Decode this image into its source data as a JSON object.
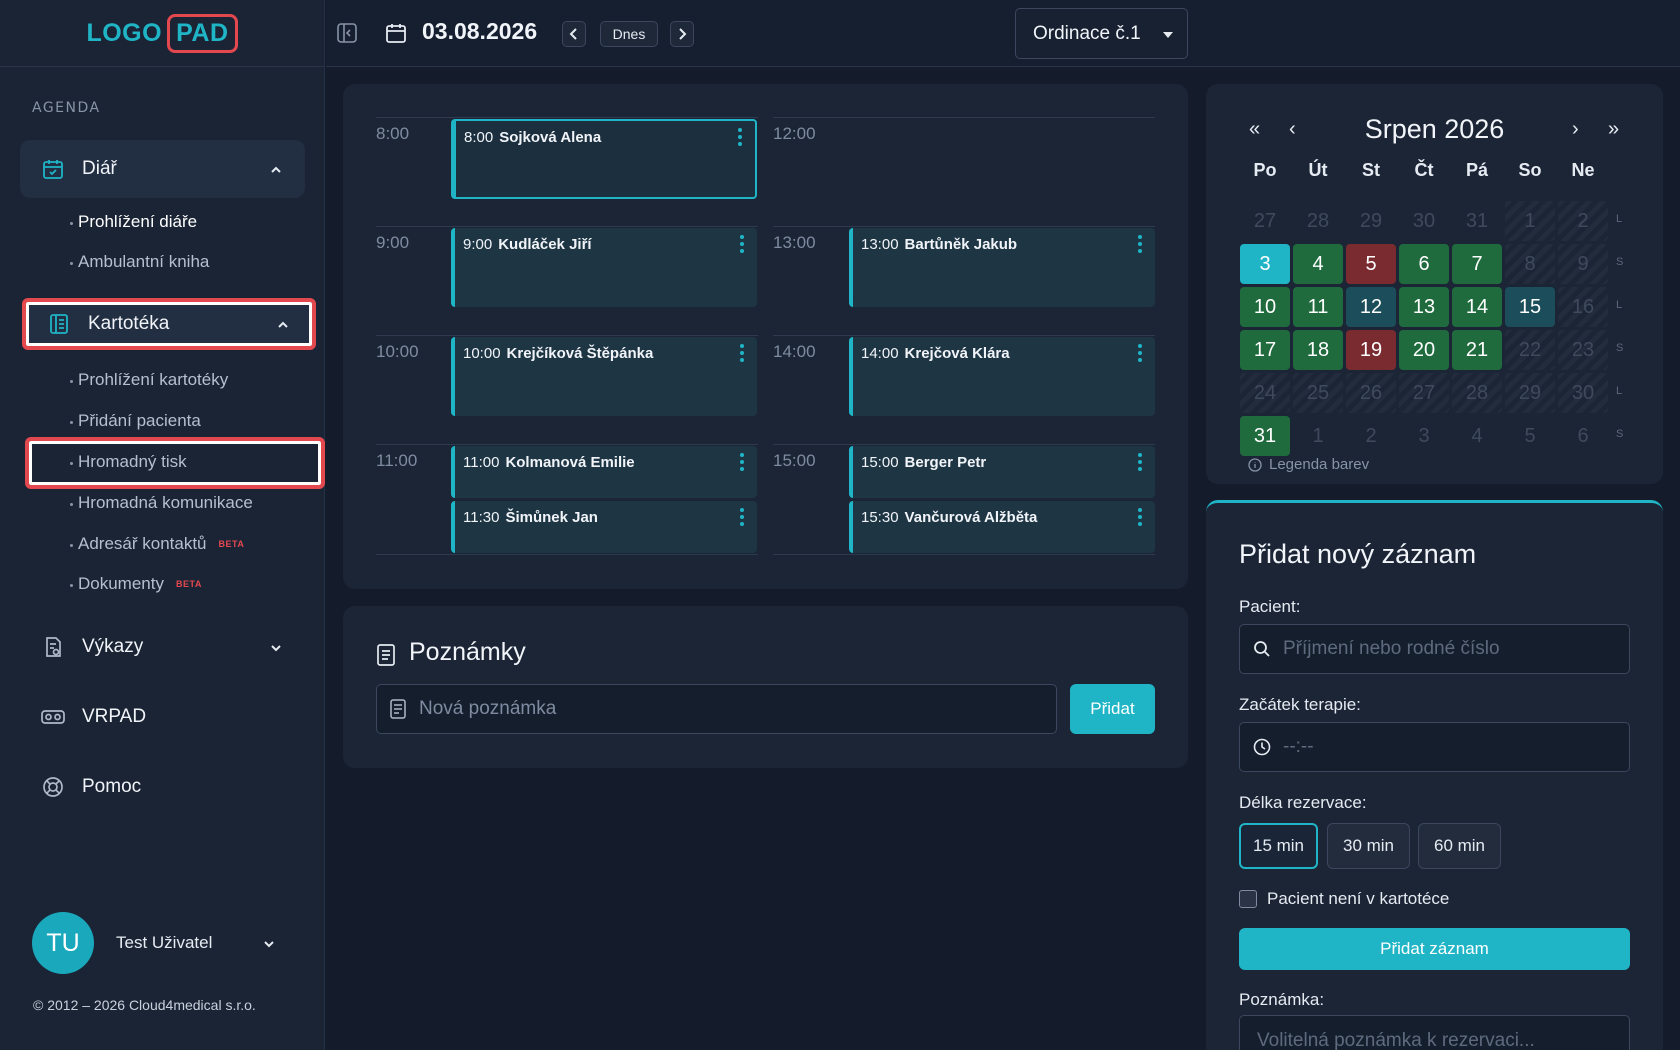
{
  "logo": {
    "part1": "LOGO",
    "part2": "PAD"
  },
  "sidebar": {
    "section_label": "AGENDA",
    "diar": {
      "label": "Diář",
      "items": [
        "Prohlížení diáře",
        "Ambulantní kniha"
      ]
    },
    "kartoteka": {
      "label": "Kartotéka",
      "items": [
        {
          "label": "Prohlížení kartotéky"
        },
        {
          "label": "Přidání pacienta"
        },
        {
          "label": "Hromadný tisk"
        },
        {
          "label": "Hromadná komunikace"
        },
        {
          "label": "Adresář kontaktů",
          "badge": "BETA"
        },
        {
          "label": "Dokumenty",
          "badge": "BETA"
        }
      ]
    },
    "vykazy": "Výkazy",
    "vrpad": "VRPAD",
    "pomoc": "Pomoc",
    "user": {
      "initials": "TU",
      "name": "Test Uživatel"
    },
    "copyright": "© 2012 – 2026 Cloud4medical s.r.o."
  },
  "topbar": {
    "date": "03.08.2026",
    "today_label": "Dnes",
    "clinic": "Ordinace č.1"
  },
  "schedule": {
    "left_times": [
      "8:00",
      "9:00",
      "10:00",
      "11:00"
    ],
    "right_times": [
      "12:00",
      "13:00",
      "14:00",
      "15:00"
    ],
    "appointments": [
      {
        "time": "8:00",
        "name": "Sojková Alena"
      },
      {
        "time": "9:00",
        "name": "Kudláček Jiří"
      },
      {
        "time": "10:00",
        "name": "Krejčíková Štěpánka"
      },
      {
        "time": "11:00",
        "name": "Kolmanová Emilie"
      },
      {
        "time": "11:30",
        "name": "Šimůnek Jan"
      },
      {
        "time": "13:00",
        "name": "Bartůněk Jakub"
      },
      {
        "time": "14:00",
        "name": "Krejčová Klára"
      },
      {
        "time": "15:00",
        "name": "Berger Petr"
      },
      {
        "time": "15:30",
        "name": "Vančurová Alžběta"
      }
    ]
  },
  "notes": {
    "title": "Poznámky",
    "placeholder": "Nová poznámka",
    "add_label": "Přidat"
  },
  "calendar": {
    "title": "Srpen 2026",
    "nav": {
      "first": "«",
      "prev": "‹",
      "next": "›",
      "last": "»"
    },
    "dow": [
      "Po",
      "Út",
      "St",
      "Čt",
      "Pá",
      "So",
      "Ne"
    ],
    "week_marks": [
      "L",
      "S",
      "L",
      "S",
      "L",
      "S"
    ],
    "rows": [
      [
        "27",
        "28",
        "29",
        "30",
        "31",
        "1",
        "2"
      ],
      [
        "3",
        "4",
        "5",
        "6",
        "7",
        "8",
        "9"
      ],
      [
        "10",
        "11",
        "12",
        "13",
        "14",
        "15",
        "16"
      ],
      [
        "17",
        "18",
        "19",
        "20",
        "21",
        "22",
        "23"
      ],
      [
        "24",
        "25",
        "26",
        "27",
        "28",
        "29",
        "30"
      ],
      [
        "31",
        "1",
        "2",
        "3",
        "4",
        "5",
        "6"
      ]
    ],
    "legend": "Legenda barev",
    "colors": {
      "green": "#1f6b3d",
      "red": "#7a2b30",
      "teal": "#1b4d5a",
      "today": "#1fb5c6"
    }
  },
  "new_record": {
    "title": "Přidat nový záznam",
    "patient_label": "Pacient:",
    "patient_placeholder": "Příjmení nebo rodné číslo",
    "start_label": "Začátek terapie:",
    "start_placeholder": "--:--",
    "duration_label": "Délka rezervace:",
    "durations": [
      "15 min",
      "30 min",
      "60 min"
    ],
    "checkbox_label": "Pacient není v kartotéce",
    "submit_label": "Přidat záznam",
    "note_label": "Poznámka:",
    "note_placeholder": "Volitelná poznámka k rezervaci..."
  }
}
